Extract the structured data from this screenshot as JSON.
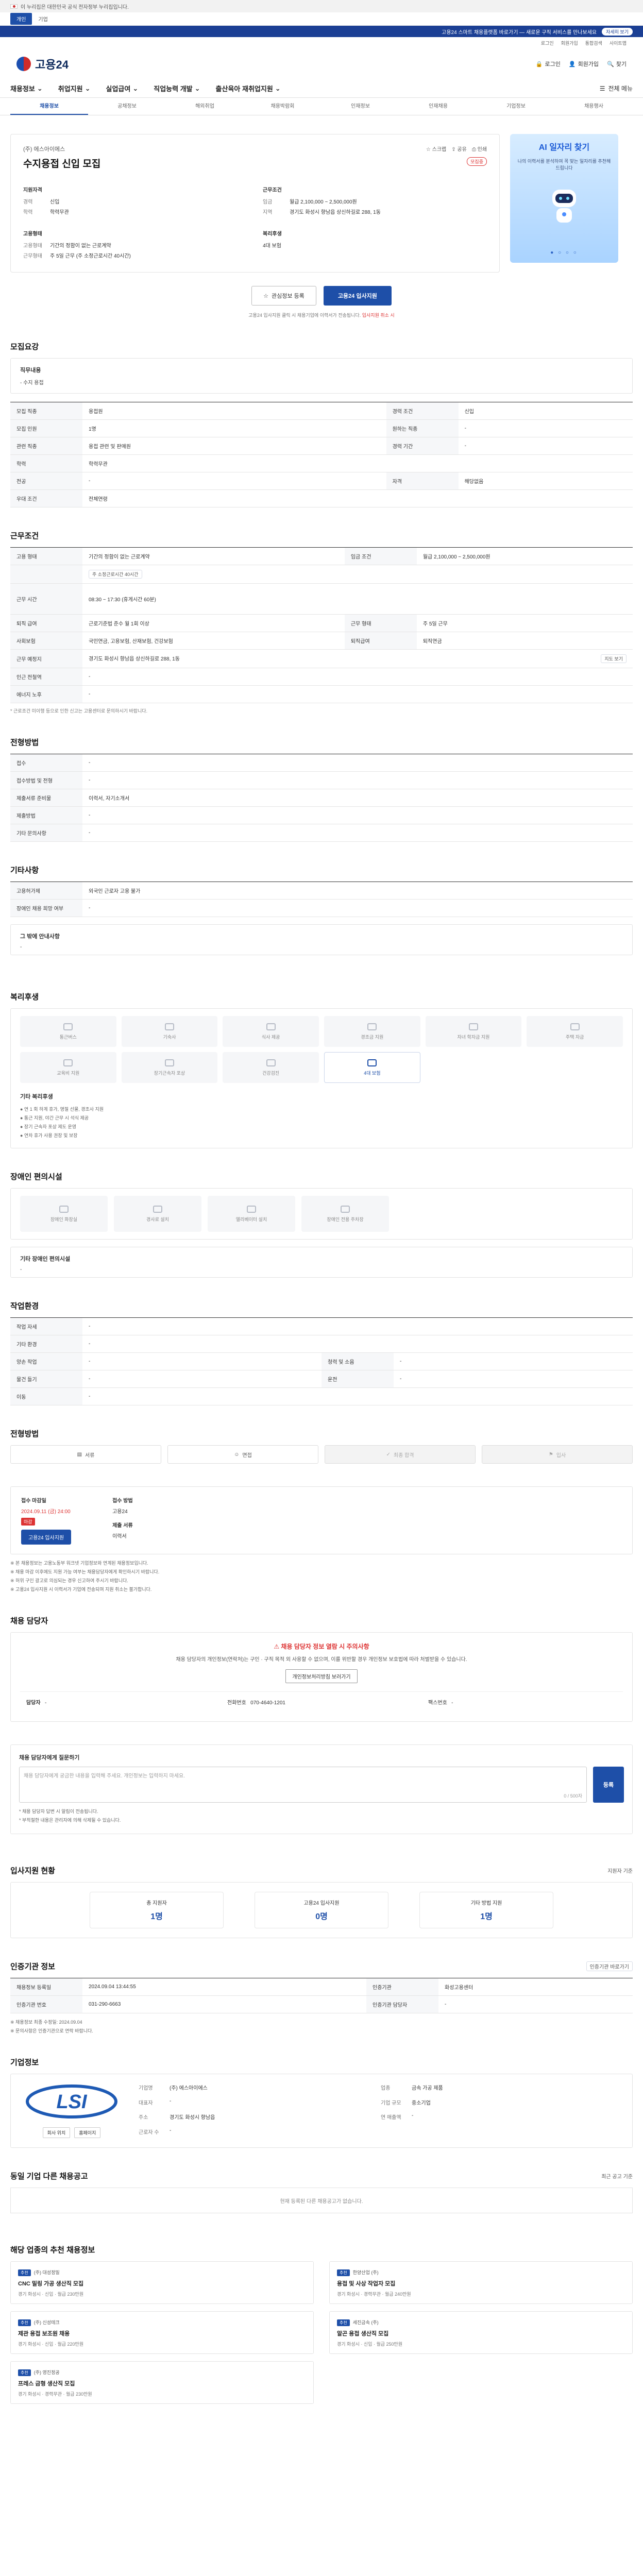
{
  "gov_notice": "이 누리집은 대한민국 공식 전자정부 누리집입니다.",
  "site_tabs": [
    "개인",
    "기업"
  ],
  "promo": {
    "text": "고용24 스마트 채용플랫폼 바로가기 — 새로운 구직 서비스를 만나보세요",
    "button": "자세히 보기"
  },
  "util_links": [
    "로그인",
    "회원가입",
    "통합검색",
    "사이트맵"
  ],
  "header": {
    "logo": "고용24",
    "links": [
      "로그인",
      "회원가입",
      "찾기"
    ]
  },
  "gnb": {
    "menus": [
      "채용정보",
      "취업지원",
      "실업급여",
      "직업능력 개발",
      "출산육아 재취업지원"
    ],
    "all_menu": "전체 메뉴"
  },
  "lnb": [
    "채용정보",
    "공채정보",
    "해외취업",
    "채용박람회",
    "인재정보",
    "인재채용",
    "기업정보",
    "채용행사"
  ],
  "job": {
    "company": "(주) 에스아이에스",
    "title": "수지용접 신입 모집",
    "actions": [
      "스크랩",
      "공유",
      "인쇄"
    ],
    "badge": "모집중",
    "blocks": [
      {
        "title": "지원자격",
        "rows": [
          [
            "경력",
            "신입"
          ],
          [
            "학력",
            "학력무관"
          ]
        ]
      },
      {
        "title": "근무조건",
        "rows": [
          [
            "임금",
            "월급 2,100,000 ~ 2,500,000원"
          ],
          [
            "지역",
            "경기도 화성시 향남읍 상신하길로 288, 1동"
          ]
        ]
      },
      {
        "title": "고용형태",
        "rows": [
          [
            "고용형태",
            "기간의 정함이 없는 근로계약"
          ],
          [
            "근무형태",
            "주 5일 근무 (주 소정근로시간 40시간)"
          ]
        ]
      },
      {
        "title": "복리후생",
        "rows": [
          [
            "",
            "4대 보험"
          ]
        ]
      }
    ]
  },
  "banner": {
    "title": "AI 일자리 찾기",
    "subtitle": "나의 이력서를 분석하여 꼭 맞는 일자리를 추천해 드립니다",
    "dots": "● ○ ○ ○"
  },
  "apply": {
    "scrap": "관심정보 등록",
    "apply": "고용24 입사지원",
    "note": "고용24 입사지원 클릭 시 채용기업에 이력서가 전송됩니다.",
    "note_red": "입사지원 취소 시"
  },
  "recruit_section": {
    "title": "모집요강",
    "duty_title": "직무내용",
    "duty_text": "- 수지 용접",
    "rows": [
      [
        "모집 직종",
        "용접원",
        "경력 조건",
        "신입"
      ],
      [
        "모집 인원",
        "1명",
        "원하는 직종",
        "-"
      ],
      [
        "관련 직종",
        "용접 관련 및 판매원",
        "경력 기간",
        "-"
      ],
      [
        "학력",
        "학력무관",
        "",
        ""
      ],
      [
        "전공",
        "-",
        "자격",
        "해당없음"
      ],
      [
        "우대 조건",
        "전체연령",
        "",
        ""
      ]
    ]
  },
  "work_section": {
    "title": "근무조건",
    "rows": [
      [
        "고용 형태",
        "기간의 정함이 없는 근로계약",
        "임금 조건",
        "월급 2,100,000 ~ 2,500,000원"
      ],
      [
        "",
        "주 소정근로시간 40시간",
        "",
        ""
      ],
      [
        "근무 시간",
        "08:30 ~ 17:30 (휴게시간 60분)",
        "",
        ""
      ],
      [
        "퇴직 급여",
        "근로기준법 준수 월 1회 이상",
        "근무 형태",
        "주 5일 근무"
      ],
      [
        "사회보험",
        "국민연금, 고용보험, 산재보험, 건강보험",
        "퇴직급여",
        "퇴직연금"
      ],
      [
        "근무 예정지",
        "경기도 화성시 향남읍 상신하길로 288, 1동",
        "",
        ""
      ],
      [
        "인근 전철역",
        "-",
        "",
        ""
      ],
      [
        "에너지 노후",
        "-",
        "",
        ""
      ]
    ],
    "map_btn": "지도 보기",
    "note": "* 근로조건 미이행 등으로 인한 신고는 고용센터로 문의하시기 바랍니다."
  },
  "apply_method": {
    "title": "전형방법",
    "rows": [
      [
        "접수",
        "-"
      ],
      [
        "접수방법 및 전형",
        "-"
      ],
      [
        "제출서류 준비물",
        "이력서, 자기소개서"
      ],
      [
        "제출방법",
        "-"
      ],
      [
        "기타 문의사항",
        "-"
      ]
    ]
  },
  "etc_section": {
    "title": "기타사항",
    "rows": [
      [
        "고용허가제",
        "외국인 근로자 고용 불가"
      ],
      [
        "장애인 채용 희망 여부",
        "-"
      ]
    ],
    "sub": "그 밖에 안내사항",
    "sub_text": "-"
  },
  "welfare": {
    "title": "복리후생",
    "items": [
      "통근버스",
      "기숙사",
      "식사 제공",
      "경조금 지원",
      "자녀 학자금 지원",
      "주택 자금",
      "교육비 지원",
      "장기근속자 포상",
      "건강검진",
      "4대 보험",
      "",
      ""
    ],
    "active": [
      9
    ],
    "list_title": "기타 복리후생",
    "list": [
      "● 연 1 회 하계 휴가, 명절 선물, 경조사 지원",
      "● 통근 지원, 야간 근무 시 석식 제공",
      "● 장기 근속자 포상 제도 운영",
      "● 연차 휴가 사용 권장 및 보장"
    ]
  },
  "disability": {
    "title": "장애인 편의시설",
    "items": [
      "장애인 화장실",
      "경사로 설치",
      "엘리베이터 설치",
      "장애인 전용 주차장"
    ],
    "sub": "기타 장애인 편의시설",
    "sub_text": "-"
  },
  "work_env": {
    "title": "작업환경",
    "rows": [
      [
        "작업 자세",
        "-",
        "",
        ""
      ],
      [
        "기타 환경",
        "-",
        "",
        ""
      ],
      [
        "양손 작업",
        "-",
        "청력 및 소음",
        "-"
      ],
      [
        "물건 들기",
        "-",
        "운전",
        "-"
      ],
      [
        "이동",
        "-",
        "",
        ""
      ]
    ]
  },
  "process": {
    "title": "전형방법",
    "steps": [
      "서류",
      "면접",
      "최종 합격",
      "입사"
    ]
  },
  "deadline": {
    "title": "접수 마감일",
    "date": "2024.09.11 (금) 24:00",
    "pill": "마감",
    "apply": "고용24 입사지원",
    "cols": [
      [
        "접수 방법",
        "고용24"
      ],
      [
        "제출 서류",
        "이력서"
      ]
    ],
    "notes": [
      "※ 본 채용정보는 고용노동부 워크넷 기업정보와 연계된 채용정보입니다.",
      "※ 채용 마감 이후에도 지원 가능 여부는 채용담당자에게 확인하시기 바랍니다.",
      "※ 허위 구인 광고로 의심되는 경우 신고하여 주시기 바랍니다.",
      "※ 고용24 입사지원 시 이력서가 기업에 전송되며 지원 취소는 불가합니다."
    ]
  },
  "contact": {
    "title": "채용 담당자",
    "warn_title": "채용 담당자 정보 열람 시 주의사항",
    "warn_text": "채용 담당자의 개인정보(연락처)는 구인 · 구직 목적 외 사용할 수 없으며, 이를 위반할 경우 개인정보 보호법에 따라 처벌받을 수 있습니다.",
    "warn_btn": "개인정보처리방침 보러가기",
    "name_label": "담당자",
    "name": "-",
    "phone_label": "전화번호",
    "phone": "070-4640-1201",
    "fax_label": "팩스번호",
    "fax": "-"
  },
  "inquiry": {
    "title": "채용 담당자에게 질문하기",
    "placeholder": "채용 담당자에게 궁금한 내용을 입력해 주세요. 개인정보는 입력하지 마세요.",
    "counter": "0 / 500자",
    "button": "등록",
    "notes": [
      "* 채용 담당자 답변 시 알림이 전송됩니다.",
      "* 부적절한 내용은 관리자에 의해 삭제될 수 있습니다."
    ]
  },
  "stats": {
    "title": "입사지원 현황",
    "right": "지원자 기준",
    "items": [
      [
        "총 지원자",
        "1명"
      ],
      [
        "고용24 입사지원",
        "0명"
      ],
      [
        "기타 방법 지원",
        "1명"
      ]
    ]
  },
  "job_info": {
    "title": "인증기관 정보",
    "right": "인증기관 바로가기",
    "rows": [
      [
        "채용정보 등록일",
        "2024.09.04 13:44:55",
        "인증기관",
        "화성고용센터"
      ],
      [
        "인증기관 번호",
        "031-290-6663",
        "인증기관 담당자",
        "-"
      ]
    ],
    "notes": [
      "※ 채용정보 최종 수정일: 2024.09.04",
      "※ 문의사항은 인증기관으로 연락 바랍니다."
    ]
  },
  "company_info": {
    "title": "기업정보",
    "logo_text": "LSI",
    "btns": [
      "회사 위치",
      "홈페이지"
    ],
    "rows": [
      [
        "기업명",
        "(주) 에스아이에스",
        "업종",
        "금속 가공 제품"
      ],
      [
        "대표자",
        "-",
        "기업 규모",
        "중소기업"
      ],
      [
        "주소",
        "경기도 화성시 향남읍",
        "연 매출액",
        "-"
      ],
      [
        "근로자 수",
        "-",
        "",
        ""
      ]
    ]
  },
  "other_jobs": {
    "title": "동일 기업 다른 채용공고",
    "right": "최근 공고 기준",
    "empty": "현재 등록된 다른 채용공고가 없습니다."
  },
  "recommend": {
    "title": "해당 업종의 추천 채용정보",
    "items": [
      {
        "badge": "추천",
        "company": "(주) 대성정밀",
        "title": "CNC 밀링 가공 생산직 모집",
        "meta": "경기 화성시 · 신입 · 월급 230만원"
      },
      {
        "badge": "추천",
        "company": "한양산업 (주)",
        "title": "용접 및 사상 작업자 모집",
        "meta": "경기 화성시 · 경력무관 · 월급 240만원"
      },
      {
        "badge": "추천",
        "company": "(주) 신성테크",
        "title": "제관 용접 보조원 채용",
        "meta": "경기 화성시 · 신입 · 월급 220만원"
      },
      {
        "badge": "추천",
        "company": "세진금속 (주)",
        "title": "알곤 용접 생산직 모집",
        "meta": "경기 화성시 · 신입 · 월급 250만원"
      },
      {
        "badge": "추천",
        "company": "(주) 영진정공",
        "title": "프레스 금형 생산직 모집",
        "meta": "경기 화성시 · 경력무관 · 월급 230만원"
      }
    ]
  }
}
